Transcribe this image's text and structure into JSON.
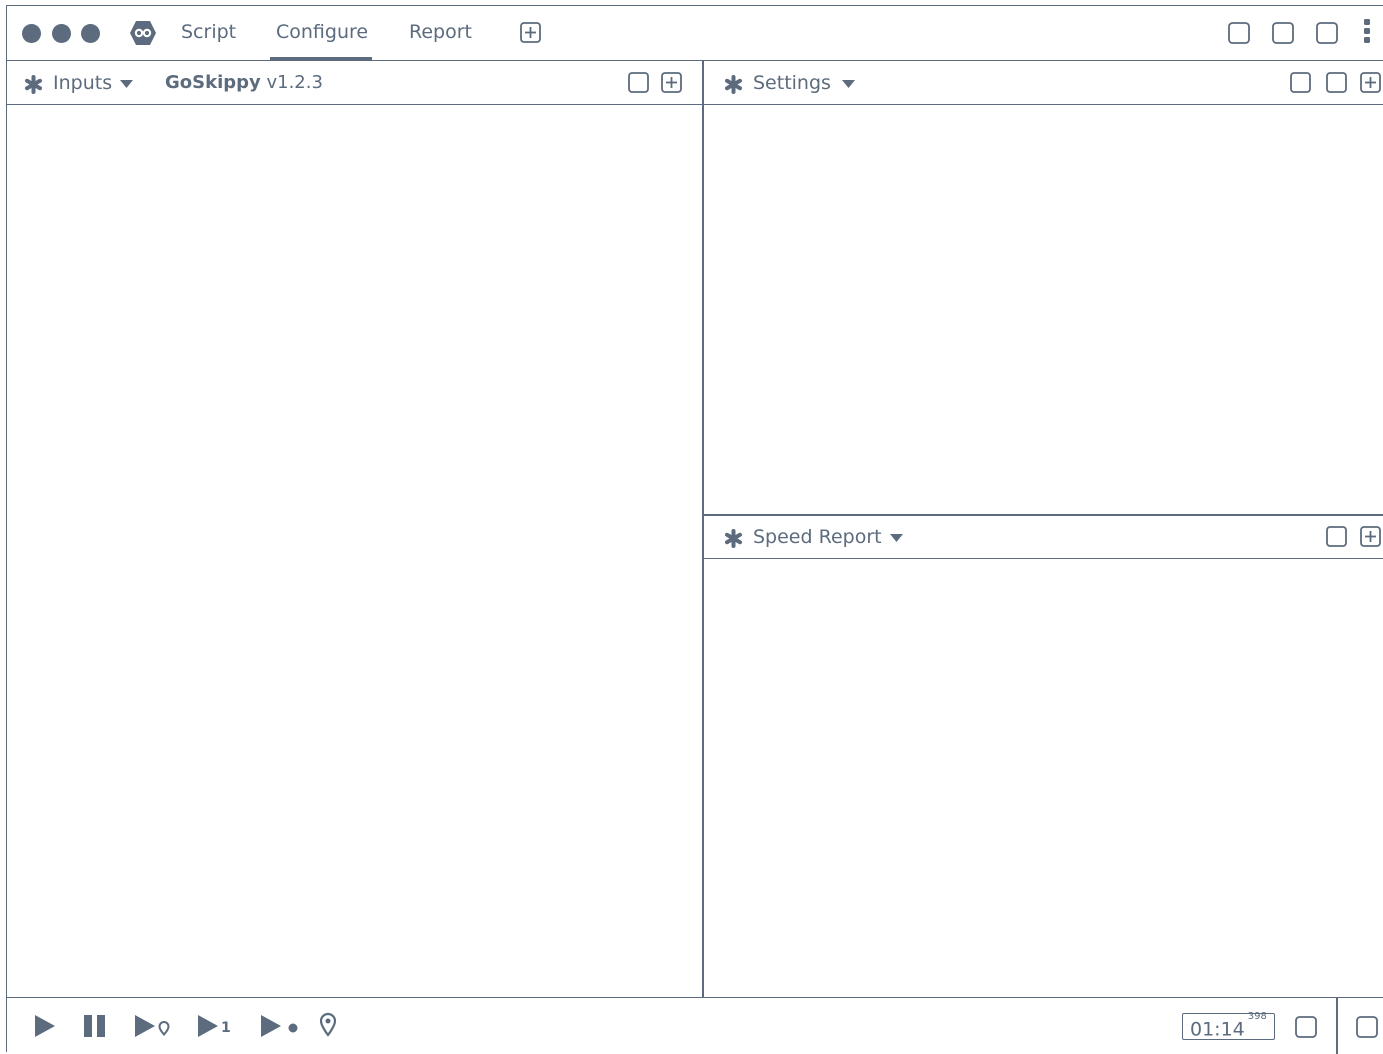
{
  "window": {
    "accent_color": "#5c6b7d",
    "traffic_lights": [
      "close",
      "minimize",
      "maximize"
    ]
  },
  "tabs": [
    {
      "label": "Script",
      "active": false
    },
    {
      "label": "Configure",
      "active": true
    },
    {
      "label": "Report",
      "active": false
    }
  ],
  "titlebar_icons": [
    "app-logo-icon",
    "add-tab-icon",
    "square-icon",
    "square-icon",
    "square-icon",
    "more-vertical-icon"
  ],
  "panels": {
    "inputs": {
      "title": "Inputs",
      "subtitle_name": "GoSkippy",
      "subtitle_version": "v1.2.3"
    },
    "settings": {
      "title": "Settings"
    },
    "speed_report": {
      "title": "Speed Report"
    }
  },
  "bottombar": {
    "controls": [
      "play-icon",
      "pause-icon",
      "play-to-marker-icon",
      "step-one-icon",
      "play-record-icon",
      "marker-icon"
    ],
    "step_label": "1",
    "timer_main": "01:14",
    "timer_fraction": "398"
  }
}
